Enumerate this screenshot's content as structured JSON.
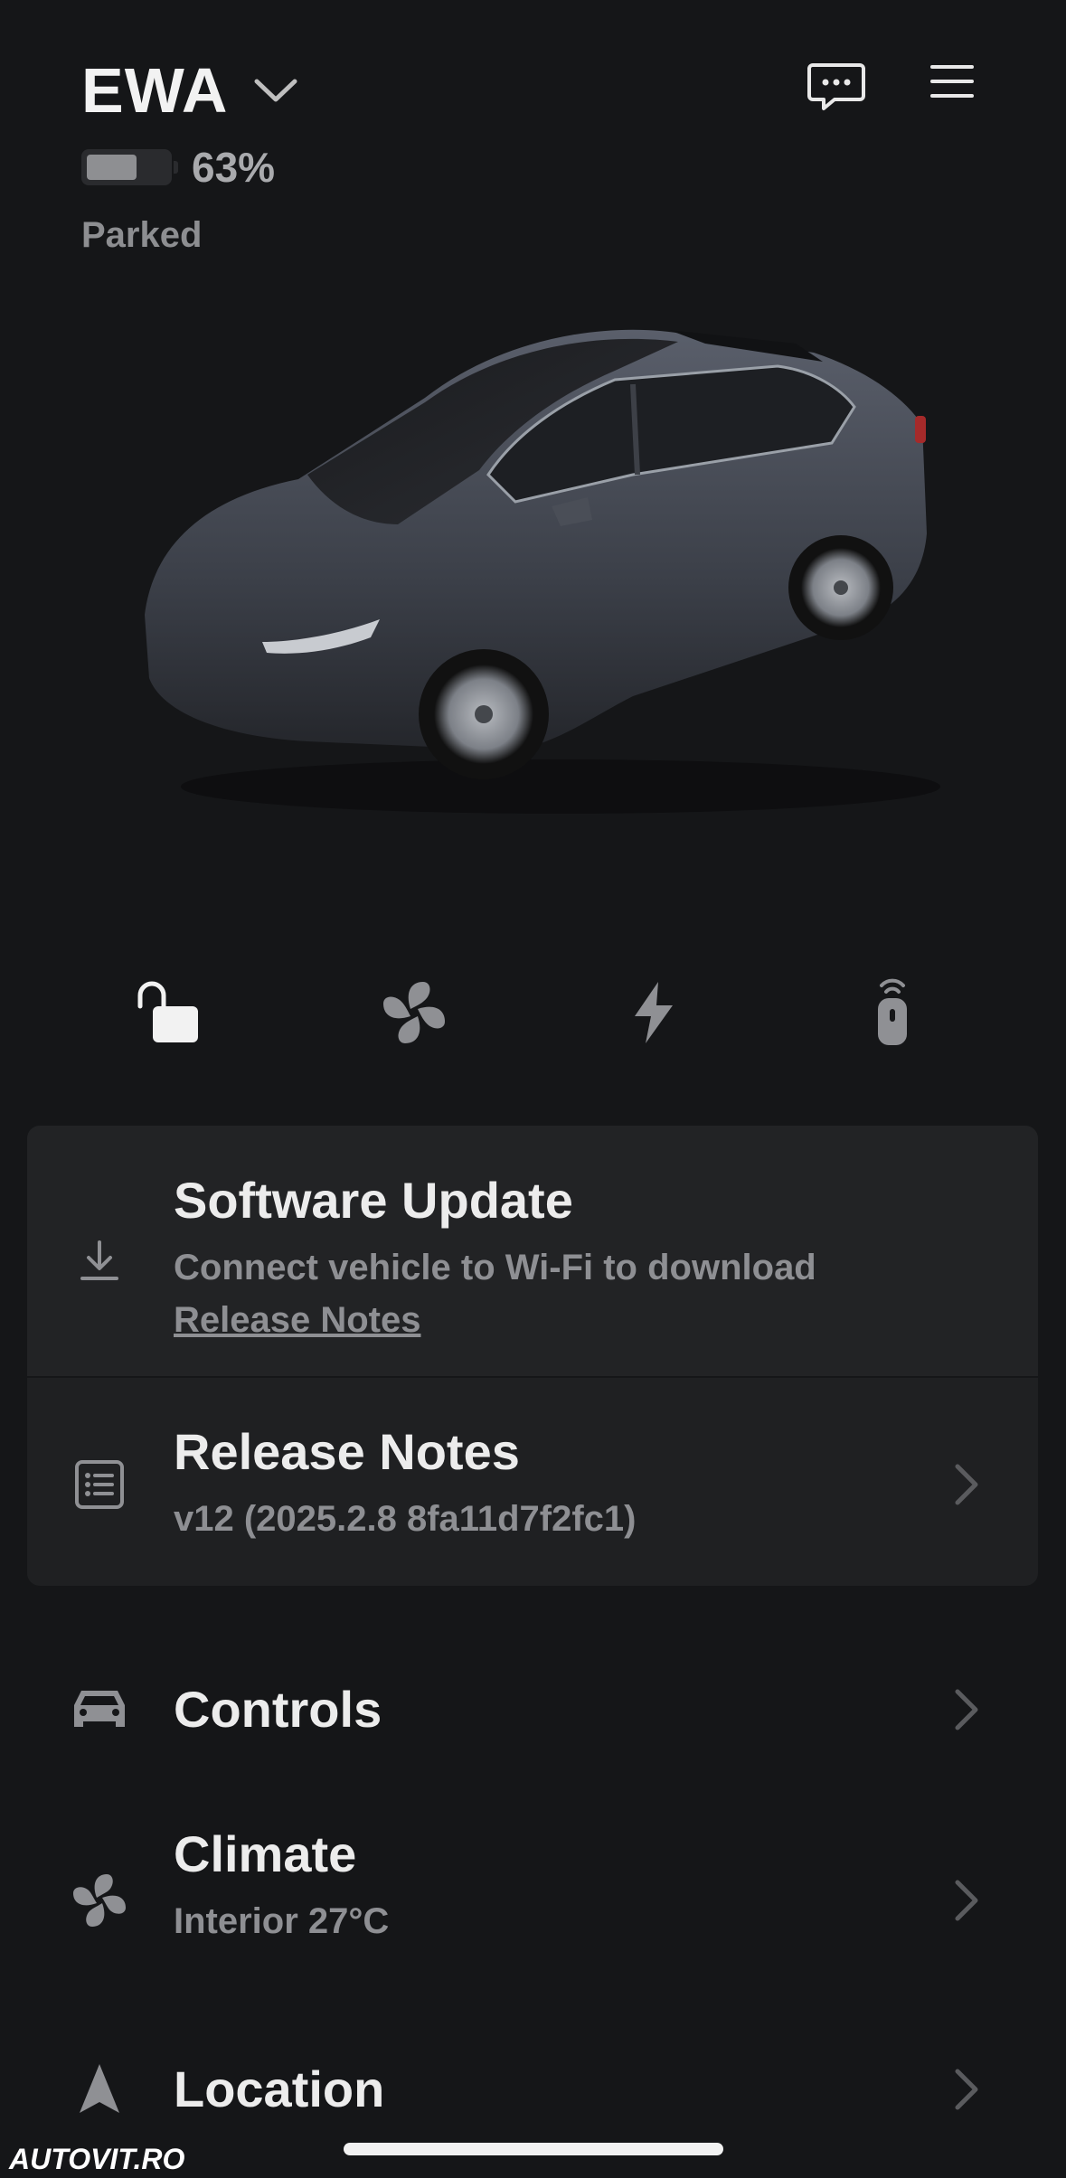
{
  "header": {
    "vehicle_name": "EWA",
    "battery_percent_label": "63%",
    "battery_level": 0.63,
    "status": "Parked"
  },
  "icons": {
    "name_dropdown": "chevron-down-icon",
    "messages": "chat-bubble-icon",
    "menu": "hamburger-menu-icon",
    "lock": "unlock-icon",
    "climate": "fan-icon",
    "charge": "lightning-bolt-icon",
    "remote": "key-fob-icon"
  },
  "software_update": {
    "title": "Software Update",
    "subtitle": "Connect vehicle to Wi-Fi to download",
    "link": "Release Notes"
  },
  "release_notes": {
    "title": "Release Notes",
    "version": "v12 (2025.2.8 8fa11d7f2fc1)"
  },
  "menu": {
    "controls": {
      "title": "Controls"
    },
    "climate": {
      "title": "Climate",
      "subtitle": "Interior 27°C"
    },
    "location": {
      "title": "Location"
    }
  },
  "watermark": "AUTOVIT.RO",
  "colors": {
    "background": "#151618",
    "card": "#222325",
    "text_primary": "#ececec",
    "text_secondary": "#8e8f93"
  }
}
